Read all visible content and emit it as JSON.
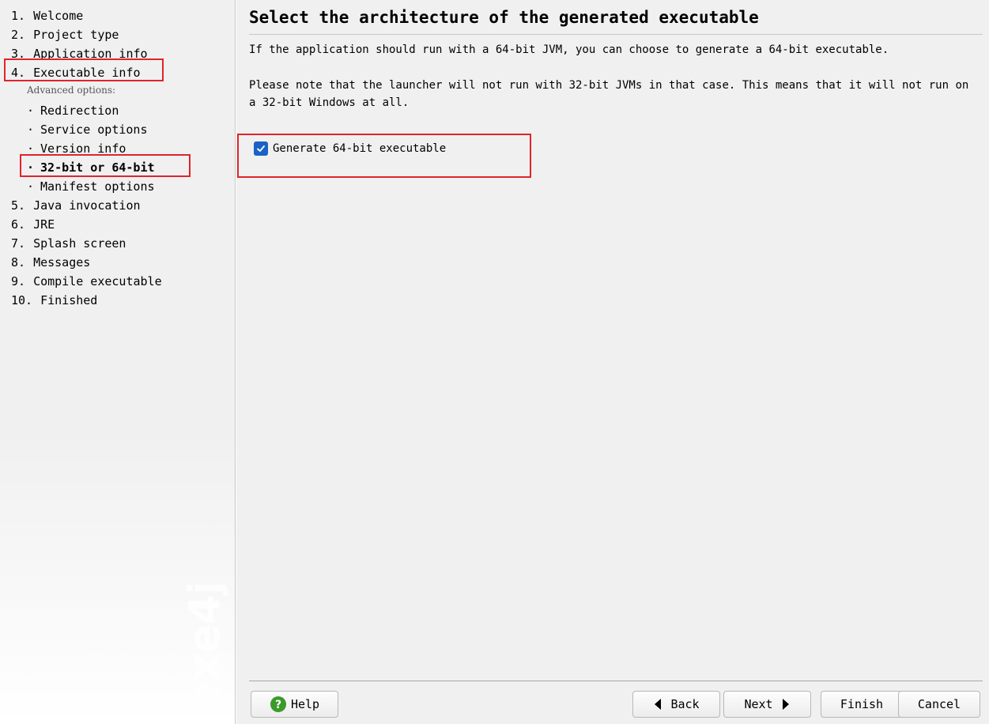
{
  "nav": {
    "items": [
      {
        "num": "1.",
        "label": "Welcome"
      },
      {
        "num": "2.",
        "label": "Project type"
      },
      {
        "num": "3.",
        "label": "Application info"
      },
      {
        "num": "4.",
        "label": "Executable info"
      },
      {
        "num": "5.",
        "label": "Java invocation"
      },
      {
        "num": "6.",
        "label": "JRE"
      },
      {
        "num": "7.",
        "label": "Splash screen"
      },
      {
        "num": "8.",
        "label": "Messages"
      },
      {
        "num": "9.",
        "label": "Compile executable"
      },
      {
        "num": "10.",
        "label": "Finished"
      }
    ],
    "advanced_label": "Advanced options:",
    "sub_bullet": "·",
    "subitems": [
      {
        "label": "Redirection"
      },
      {
        "label": "Service options"
      },
      {
        "label": "Version info"
      },
      {
        "label": "32-bit or 64-bit"
      },
      {
        "label": "Manifest options"
      }
    ],
    "watermark": "exe4j"
  },
  "page": {
    "title": "Select the architecture of the generated executable",
    "para1": "If the application should run with a 64-bit JVM, you can choose to generate a 64-bit executable.",
    "para2": "Please note that the launcher will not run with 32-bit JVMs in that case. This means that it will not run on a 32-bit Windows at all.",
    "checkbox_label": "Generate 64-bit executable",
    "checkbox_checked": true
  },
  "buttons": {
    "help": "Help",
    "back": "Back",
    "next": "Next",
    "finish": "Finish",
    "cancel": "Cancel"
  },
  "colors": {
    "highlight": "#e0242c",
    "checkbox": "#1a62c6",
    "help_icon": "#3a9a2a"
  }
}
